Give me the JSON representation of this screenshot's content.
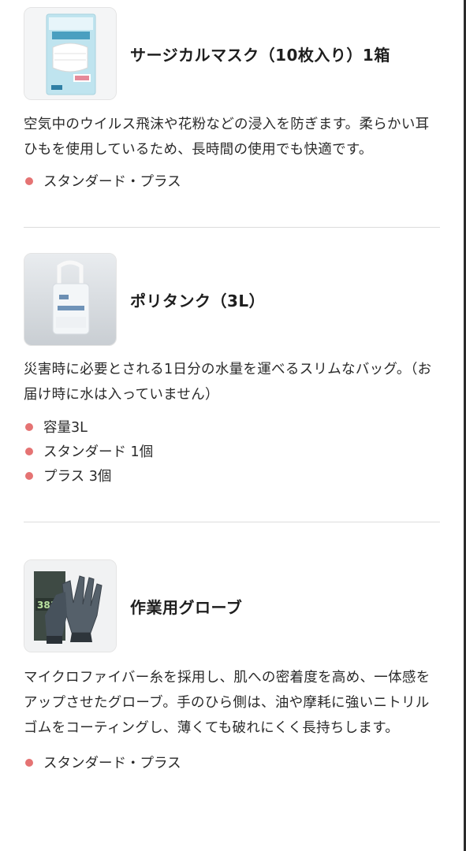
{
  "products": [
    {
      "title": "サージカルマスク（10枚入り）1箱",
      "description": "空気中のウイルス飛沫や花粉などの浸入を防ぎます。柔らかい耳ひもを使用しているため、長時間の使用でも快適です。",
      "specs": [
        "スタンダード・プラス"
      ],
      "image_icon": "mask-box-icon"
    },
    {
      "title": "ポリタンク（3L）",
      "description": "災害時に必要とされる1日分の水量を運べるスリムなバッグ。（お届け時に水は入っていません）",
      "specs": [
        "容量3L",
        "スタンダード 1個",
        "プラス 3個"
      ],
      "image_icon": "water-bag-icon"
    },
    {
      "title": "作業用グローブ",
      "description": "マイクロファイバー糸を採用し、肌への密着度を高め、一体感をアップさせたグローブ。手のひら側は、油や摩耗に強いニトリルゴムをコーティングし、薄くても破れにくく長持ちします。",
      "specs": [
        "スタンダード・プラス"
      ],
      "image_icon": "work-gloves-icon",
      "package_label": "381"
    }
  ],
  "colors": {
    "bullet": "#e57373",
    "divider": "#dcdcdc",
    "text": "#2a2a2a"
  }
}
